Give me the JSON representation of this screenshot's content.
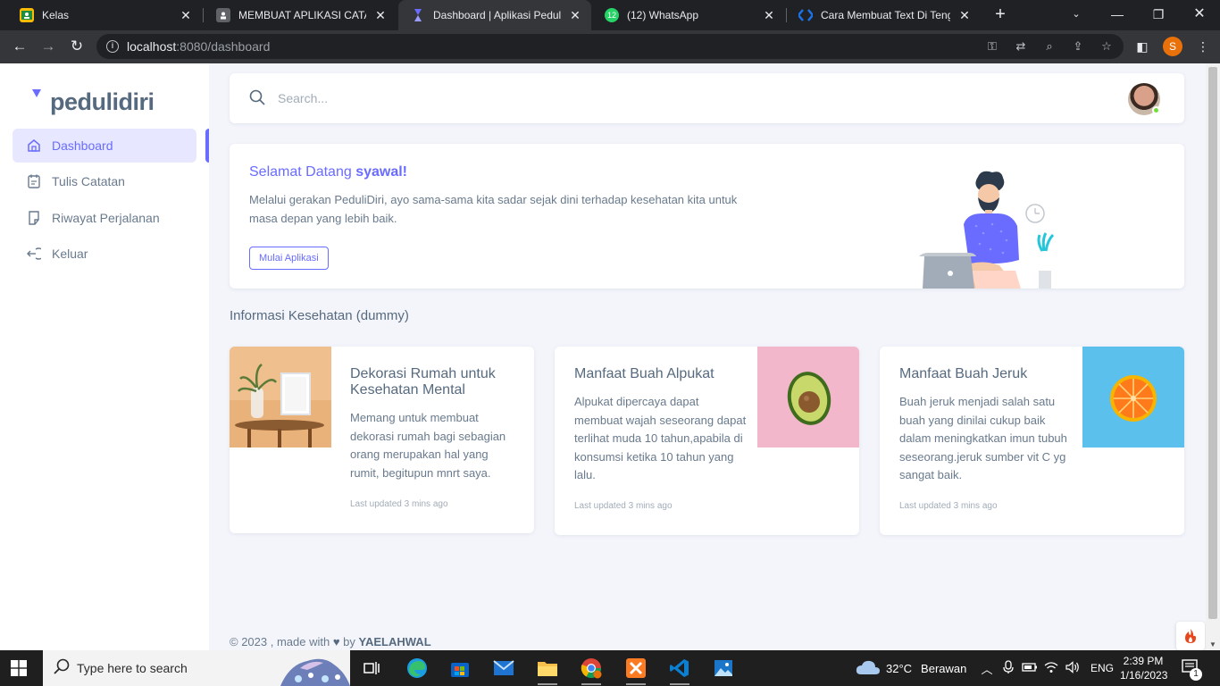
{
  "browser": {
    "tabs": [
      {
        "title": "Kelas",
        "favicon": "classroom",
        "active": false
      },
      {
        "title": "MEMBUAT APLIKASI CATATAN",
        "favicon": "document",
        "active": false
      },
      {
        "title": "Dashboard | Aplikasi PeduliDiri",
        "favicon": "sneat",
        "active": true
      },
      {
        "title": "(12) WhatsApp",
        "favicon": "whatsapp",
        "badge": "12",
        "active": false
      },
      {
        "title": "Cara Membuat Text Di Tengah",
        "favicon": "blogger",
        "active": false
      }
    ],
    "url_host": "localhost",
    "url_rest": ":8080/dashboard",
    "profile_initial": "S"
  },
  "sidebar": {
    "logo_text": "pedulidiri",
    "items": [
      {
        "label": "Dashboard",
        "icon": "home-icon",
        "active": true
      },
      {
        "label": "Tulis Catatan",
        "icon": "notebook-icon",
        "active": false
      },
      {
        "label": "Riwayat Perjalanan",
        "icon": "history-icon",
        "active": false
      },
      {
        "label": "Keluar",
        "icon": "logout-icon",
        "active": false
      }
    ]
  },
  "navbar": {
    "search_placeholder": "Search..."
  },
  "welcome": {
    "title_prefix": "Selamat Datang ",
    "title_name": "syawal!",
    "body": "Melalui gerakan PeduliDiri, ayo sama-sama kita sadar sejak dini terhadap kesehatan kita untuk masa depan yang lebih baik.",
    "button": "Mulai Aplikasi"
  },
  "section_title": "Informasi Kesehatan (dummy)",
  "cards": [
    {
      "title": "Dekorasi Rumah untuk Kesehatan Mental",
      "body": "Memang untuk membuat dekorasi rumah bagi sebagian orang merupakan hal yang rumit, begitupun mnrt saya.",
      "meta": "Last updated 3 mins ago"
    },
    {
      "title": "Manfaat Buah Alpukat",
      "body": "Alpukat dipercaya dapat membuat wajah seseorang dapat terlihat muda 10 tahun,apabila di konsumsi ketika 10 tahun yang lalu.",
      "meta": "Last updated 3 mins ago"
    },
    {
      "title": "Manfaat Buah Jeruk",
      "body": "Buah jeruk menjadi salah satu buah yang dinilai cukup baik dalam meningkatkan imun tubuh seseorang.jeruk sumber vit C yg sangat baik.",
      "meta": "Last updated 3 mins ago"
    }
  ],
  "footer": {
    "prefix": "© 2023 , made with ",
    "by": " by ",
    "author": "YAELAHWAL"
  },
  "taskbar": {
    "search_placeholder": "Type here to search",
    "weather_temp": "32°C",
    "weather_text": "Berawan",
    "language": "ENG",
    "time": "2:39 PM",
    "date": "1/16/2023",
    "notification_count": "1"
  },
  "colors": {
    "accent": "#696cff",
    "sidebar_active_bg": "#e7e7ff",
    "page_bg": "#f4f5fb"
  }
}
